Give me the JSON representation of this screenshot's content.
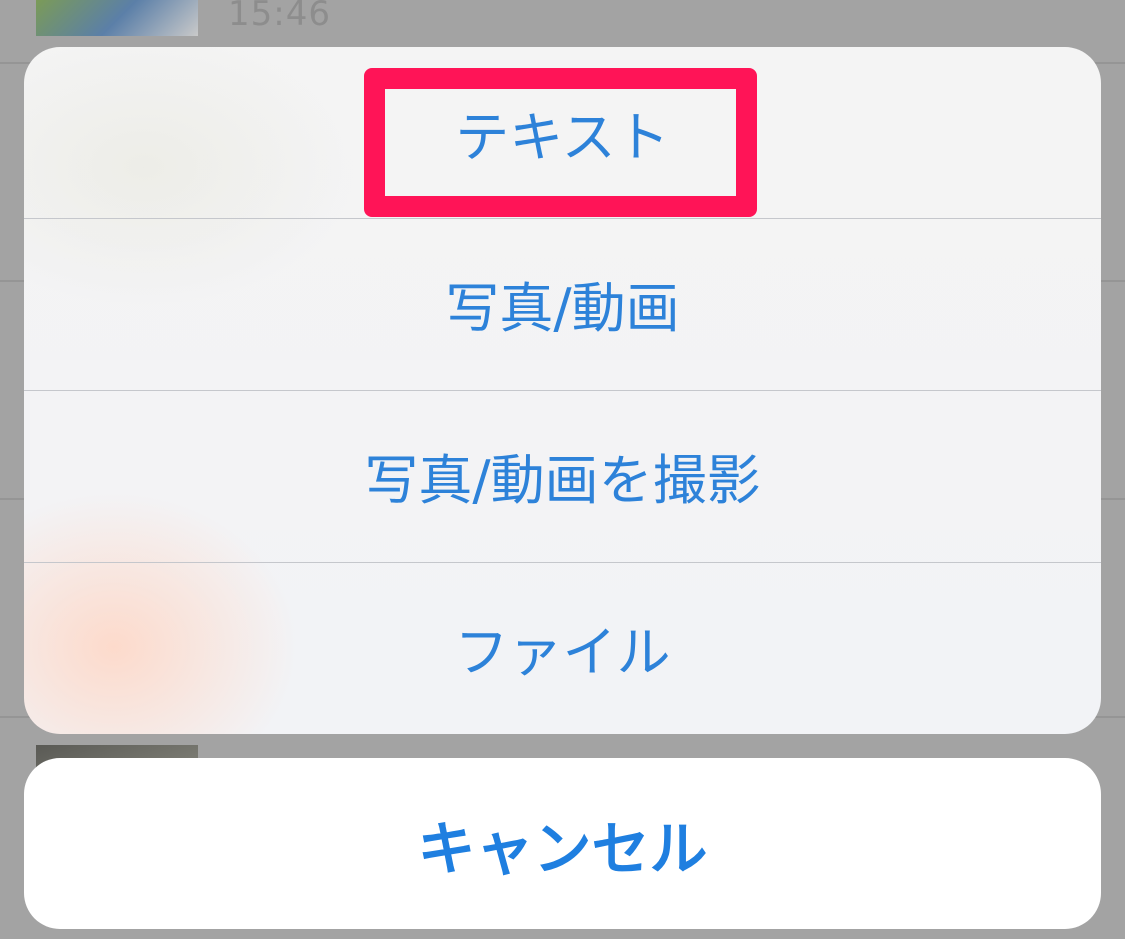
{
  "background": {
    "first_item_time": "15:46"
  },
  "action_sheet": {
    "items": [
      {
        "label": "テキスト"
      },
      {
        "label": "写真/動画"
      },
      {
        "label": "写真/動画を撮影"
      },
      {
        "label": "ファイル"
      }
    ],
    "cancel_label": "キャンセル"
  },
  "colors": {
    "action_text": "#2d82d9",
    "cancel_text": "#1f7fe0",
    "highlight": "#ff1457",
    "sheet_background": "#f4f4f4",
    "dim_background": "#9c9c9c"
  }
}
